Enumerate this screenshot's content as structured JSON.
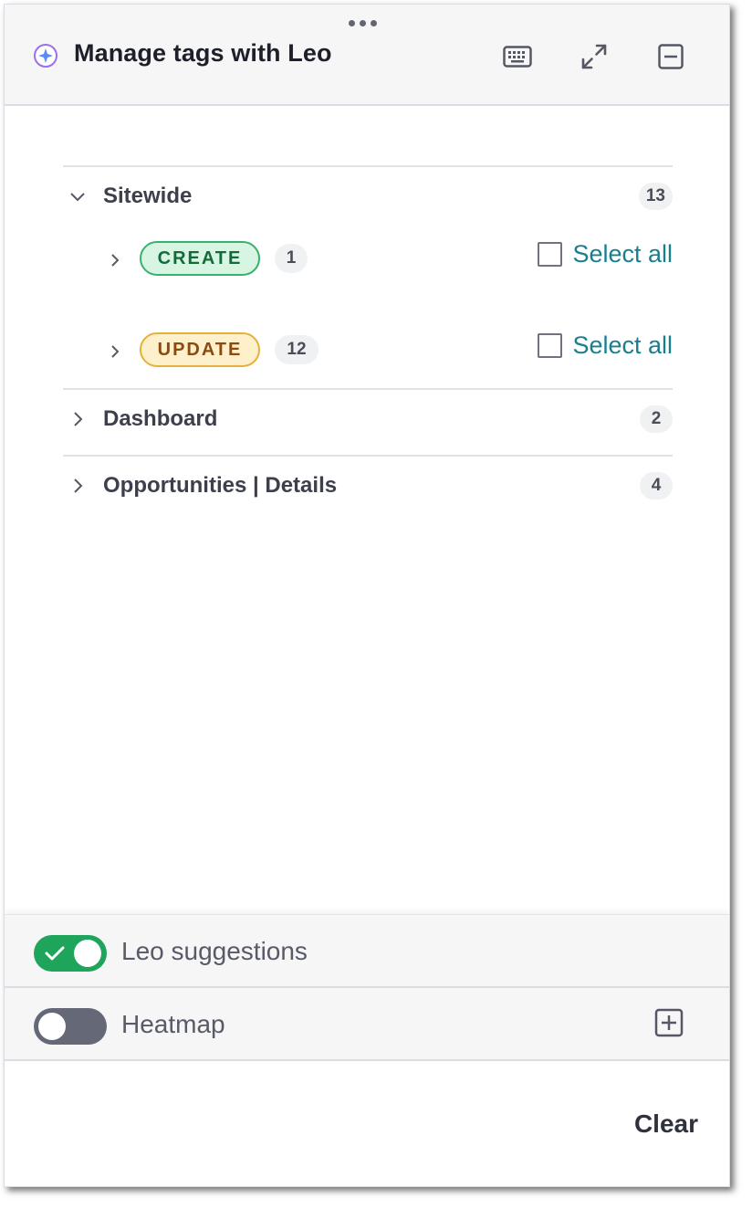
{
  "header": {
    "title": "Manage tags with Leo",
    "icons": {
      "leo": "sparkle-icon",
      "drag": "drag-handle-icon",
      "keyboard": "keyboard-icon",
      "expand": "expand-icon",
      "minimize": "minimize-icon"
    }
  },
  "sections": [
    {
      "label": "Sitewide",
      "count": "13",
      "expanded": true,
      "groups": [
        {
          "tag": "CREATE",
          "count": "1",
          "select_label": "Select all",
          "checked": false
        },
        {
          "tag": "UPDATE",
          "count": "12",
          "select_label": "Select all",
          "checked": false
        }
      ]
    },
    {
      "label": "Dashboard",
      "count": "2",
      "expanded": false
    },
    {
      "label": "Opportunities | Details",
      "count": "4",
      "expanded": false
    }
  ],
  "toggles": [
    {
      "label": "Leo suggestions",
      "on": true
    },
    {
      "label": "Heatmap",
      "on": false
    }
  ],
  "footer": {
    "clear_label": "Clear"
  },
  "colors": {
    "create_bg": "#d8f5e4",
    "create_text": "#136b3a",
    "update_bg": "#fdf0cb",
    "update_text": "#8c4a0f",
    "link": "#197f8d",
    "toggle_on": "#1fa55b",
    "toggle_off": "#656876"
  }
}
